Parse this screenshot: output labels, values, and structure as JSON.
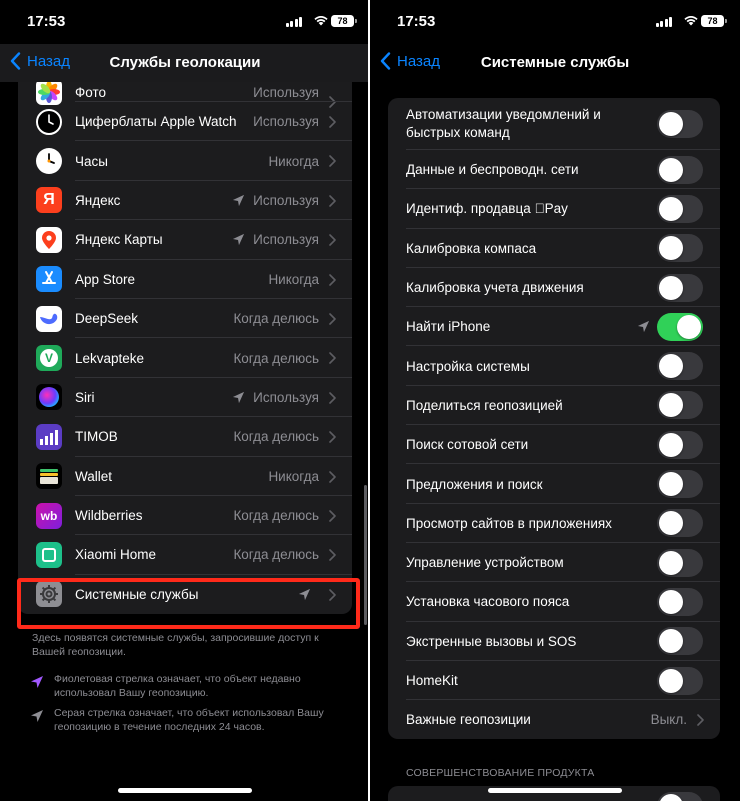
{
  "left": {
    "status": {
      "time": "17:53",
      "battery": "78"
    },
    "nav": {
      "back": "Назад",
      "title": "Службы геолокации"
    },
    "rows": [
      {
        "label": "Фото",
        "value": "Используя",
        "icon": "photos-icon",
        "arrow": false
      },
      {
        "label": "Циферблаты Apple Watch",
        "value": "Используя",
        "icon": "watch-faces-icon",
        "arrow": false
      },
      {
        "label": "Часы",
        "value": "Никогда",
        "icon": "clock-icon",
        "arrow": false
      },
      {
        "label": "Яндекс",
        "value": "Используя",
        "icon": "yandex-icon",
        "arrow": true
      },
      {
        "label": "Яндекс Карты",
        "value": "Используя",
        "icon": "yandex-maps-icon",
        "arrow": true
      },
      {
        "label": "App Store",
        "value": "Никогда",
        "icon": "app-store-icon",
        "arrow": false
      },
      {
        "label": "DeepSeek",
        "value": "Когда делюсь",
        "icon": "deepseek-icon",
        "arrow": false
      },
      {
        "label": "Lekvapteke",
        "value": "Когда делюсь",
        "icon": "lekvapteke-icon",
        "arrow": false
      },
      {
        "label": "Siri",
        "value": "Используя",
        "icon": "siri-icon",
        "arrow": true
      },
      {
        "label": "TIMOB",
        "value": "Когда делюсь",
        "icon": "timob-icon",
        "arrow": false
      },
      {
        "label": "Wallet",
        "value": "Никогда",
        "icon": "wallet-icon",
        "arrow": false
      },
      {
        "label": "Wildberries",
        "value": "Когда делюсь",
        "icon": "wildberries-icon",
        "arrow": false
      },
      {
        "label": "Xiaomi Home",
        "value": "Когда делюсь",
        "icon": "xiaomi-home-icon",
        "arrow": false
      },
      {
        "label": "Системные службы",
        "value": "",
        "icon": "settings-gear-icon",
        "arrow": true
      }
    ],
    "footer": "Здесь появятся системные службы, запросившие доступ к Вашей геопозиции.",
    "purple_note": "Фиолетовая стрелка означает, что объект недавно использовал Вашу геопозицию.",
    "gray_note": "Серая стрелка означает, что объект использовал Вашу геопозицию в течение последних 24 часов."
  },
  "right": {
    "status": {
      "time": "17:53",
      "battery": "78"
    },
    "nav": {
      "back": "Назад",
      "title": "Системные службы"
    },
    "rows": [
      {
        "label": "Автоматизации уведомлений и быстрых команд",
        "type": "toggle",
        "on": false,
        "tall": true
      },
      {
        "label": "Данные и беспроводн. сети",
        "type": "toggle",
        "on": false
      },
      {
        "label": "Идентиф. продавца Pay",
        "type": "toggle",
        "on": false
      },
      {
        "label": "Калибровка компаса",
        "type": "toggle",
        "on": false
      },
      {
        "label": "Калибровка учета движения",
        "type": "toggle",
        "on": false
      },
      {
        "label": "Найти iPhone",
        "type": "toggle",
        "on": true,
        "arrow": true
      },
      {
        "label": "Настройка системы",
        "type": "toggle",
        "on": false
      },
      {
        "label": "Поделиться геопозицией",
        "type": "toggle",
        "on": false
      },
      {
        "label": "Поиск сотовой сети",
        "type": "toggle",
        "on": false
      },
      {
        "label": "Предложения и поиск",
        "type": "toggle",
        "on": false
      },
      {
        "label": "Просмотр сайтов в приложениях",
        "type": "toggle",
        "on": false
      },
      {
        "label": "Управление устройством",
        "type": "toggle",
        "on": false
      },
      {
        "label": "Установка часового пояса",
        "type": "toggle",
        "on": false
      },
      {
        "label": "Экстренные вызовы и SOS",
        "type": "toggle",
        "on": false
      },
      {
        "label": "HomeKit",
        "type": "toggle",
        "on": false
      },
      {
        "label": "Важные геопозиции",
        "type": "link",
        "value": "Выкл."
      }
    ],
    "section_header": "СОВЕРШЕНСТВОВАНИЕ ПРОДУКТА"
  },
  "colors": {
    "accent": "#0a84ff",
    "toggle_on": "#30d158",
    "highlight": "#ff2a1a",
    "purple_arrow": "#a259ff"
  }
}
